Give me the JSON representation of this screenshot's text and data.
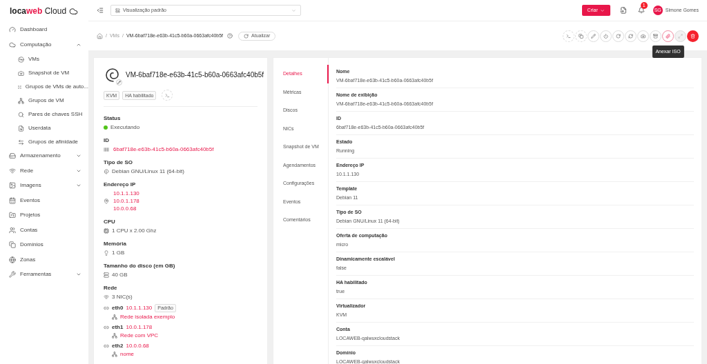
{
  "logo": {
    "first": "loca",
    "accent": "web",
    "rest": "Cloud"
  },
  "sidebar": {
    "items": [
      {
        "label": "Dashboard"
      },
      {
        "label": "Computação",
        "expanded": true,
        "children": [
          {
            "label": "VMs"
          },
          {
            "label": "Snapshot de VM"
          },
          {
            "label": "Grupos de VMs de auto..."
          },
          {
            "label": "Grupos de VM"
          },
          {
            "label": "Pares de chaves SSH"
          },
          {
            "label": "Userdata"
          },
          {
            "label": "Grupos de afinidade"
          }
        ]
      },
      {
        "label": "Armazenamento",
        "expanded": false
      },
      {
        "label": "Rede",
        "expanded": false
      },
      {
        "label": "Imagens",
        "expanded": false
      },
      {
        "label": "Eventos"
      },
      {
        "label": "Projetos"
      },
      {
        "label": "Contas"
      },
      {
        "label": "Domínios"
      },
      {
        "label": "Zonas"
      },
      {
        "label": "Ferramentas",
        "expanded": false
      }
    ]
  },
  "header": {
    "view_select": {
      "value": "Visualização padrão"
    },
    "create_button": "Criar",
    "notification_count": "1",
    "user": {
      "initials": "SG",
      "name": "Simone Gomes"
    }
  },
  "breadcrumb": {
    "separator": "/",
    "items": [
      "VMs",
      "VM-6baf718e-e63b-41c5-b60a-0663afc40b5f"
    ],
    "refresh_button": "Atualizar"
  },
  "actions": [
    {
      "kind": "dashed"
    },
    {
      "kind": "dashed"
    },
    {
      "kind": "normal"
    },
    {
      "kind": "normal"
    },
    {
      "kind": "normal"
    },
    {
      "kind": "normal"
    },
    {
      "kind": "normal"
    },
    {
      "kind": "normal"
    },
    {
      "kind": "highlighted"
    },
    {
      "kind": "disabled"
    },
    {
      "kind": "danger"
    }
  ],
  "tooltip": "Anexar ISO",
  "summary": {
    "name": "VM-6baf718e-e63b-41c5-b60a-0663afc40b5f",
    "tags": [
      "KVM",
      "HA habilitado"
    ],
    "status": {
      "label": "Status",
      "value": "Executando",
      "color": "#52c41a"
    },
    "id": {
      "label": "ID",
      "value": "6baf718e-e63b-41c5-b60a-0663afc40b5f"
    },
    "os": {
      "label": "Tipo de SO",
      "value": "Debian GNU/Linux 11 (64-bit)"
    },
    "ip": {
      "label": "Endereço IP",
      "values": [
        "10.1.1.130",
        "10.0.1.178",
        "10.0.0.68"
      ]
    },
    "cpu": {
      "label": "CPU",
      "value": "1 CPU x 2.00 Ghz"
    },
    "memory": {
      "label": "Memória",
      "value": "1 GB"
    },
    "disk": {
      "label": "Tamanho do disco (em GB)",
      "value": "40 GB"
    },
    "network": {
      "label": "Rede",
      "count": "3 NIC(s)",
      "nics": [
        {
          "name": "eth0",
          "ip": "10.1.1.130",
          "tag": "Padrão",
          "network": "Rede isolada exemplo"
        },
        {
          "name": "eth1",
          "ip": "10.0.1.178",
          "network": "Rede com VPC"
        },
        {
          "name": "eth2",
          "ip": "10.0.0.68",
          "network": "nome"
        }
      ]
    }
  },
  "tabs": [
    {
      "label": "Detalhes",
      "selected": true
    },
    {
      "label": "Métricas",
      "selected": false
    },
    {
      "label": "Discos",
      "selected": false
    },
    {
      "label": "NICs",
      "selected": false
    },
    {
      "label": "Snapshot de VM",
      "selected": false
    },
    {
      "label": "Agendamentos",
      "selected": false
    },
    {
      "label": "Configurações",
      "selected": false
    },
    {
      "label": "Eventos",
      "selected": false
    },
    {
      "label": "Comentários",
      "selected": false
    }
  ],
  "details": [
    {
      "label": "Nome",
      "value": "VM-6baf718e-e63b-41c5-b60a-0663afc40b5f"
    },
    {
      "label": "Nome de exibição",
      "value": "VM-6baf718e-e63b-41c5-b60a-0663afc40b5f"
    },
    {
      "label": "ID",
      "value": "6baf718e-e63b-41c5-b60a-0663afc40b5f"
    },
    {
      "label": "Estado",
      "value": "Running"
    },
    {
      "label": "Endereço IP",
      "value": "10.1.1.130"
    },
    {
      "label": "Template",
      "value": "Debian 11"
    },
    {
      "label": "Tipo de SO",
      "value": "Debian GNU/Linux 11 (64-bit)"
    },
    {
      "label": "Oferta de computação",
      "value": "micro"
    },
    {
      "label": "Dinamicamente escalável",
      "value": "false"
    },
    {
      "label": "HA habilitado",
      "value": "true"
    },
    {
      "label": "Virtualizador",
      "value": "KVM"
    },
    {
      "label": "Conta",
      "value": "LOCAWEB-qalwuxcloudstack"
    },
    {
      "label": "Domínio",
      "value": "LOCAWEB-qalwuxcloudstack"
    }
  ]
}
